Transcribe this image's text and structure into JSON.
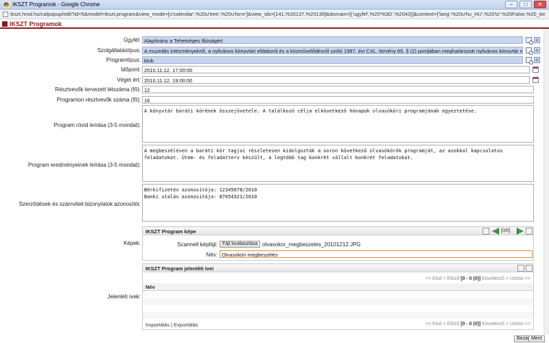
{
  "window": {
    "title": "IKSZT Programok - Google Chrome",
    "url": "ikszt.hrod.hu/calpopup/edit?id=5&model=ikszt.program&view_mode=[u'calendar',%20u'tree',%20u'form']&view_ids=[141,%20137,%20139]&domain=[('ugyfel',%20'%3D',%2043)]&context={'lang':%20u'hu_HU',%20'tz':%20False,%20_terp"
  },
  "app": {
    "title": "IKSZT Programok"
  },
  "form": {
    "ugyfel": {
      "label": "Ügyfél:",
      "value": "Alapítvány a Tehetséges Ifjúságért"
    },
    "szolgaltatas": {
      "label": "Szolgáltatástípus:",
      "value": "A muzeális intézményekről, a nyilvános könyvtári ellátásról és a közművelődésről szóló 1997. évi CXL. törvény 65. § (2) pontjában meghatározott nyilvános könyvtár működtetése vagy"
    },
    "programtipus": {
      "label": "Programtípus:",
      "value": "klub"
    },
    "idopont": {
      "label": "Időpont:",
      "value": "2010.11.12. 17:00:00"
    },
    "veget_ert": {
      "label": "Véget ért:",
      "value": "2010.11.12. 19:00:00"
    },
    "tervezett_letszam": {
      "label": "Résztvevők tervezett létszáma (fő):",
      "value": "12"
    },
    "resztvevok_szama": {
      "label": "Programon résztvevők száma (fő):",
      "value": "16"
    },
    "rovid_leiras": {
      "label": "Program rövid leírása (3-5 mondat):",
      "value": "A könyvtár baráti körének összejövetele. A találkozó célja elkövetkező hónapok olvasóköri programjának egyeztetése."
    },
    "eredmenyek": {
      "label": "Program eredményeinek leírása (3-5 mondat):",
      "value": "A megbeszélésen a baráti kör tagjai részletesen kidolgozták a soron következő olvasókörök programját, az azokkal kapcsolatos feladatokat. Ütem- és feladatterv készült, a legtöbb tag konkrét vállalt konkrét feladatokat."
    },
    "szerzodesek": {
      "label": "Szerződések és számviteli bizonylatok azonosítói:",
      "value": "Bérkifizetés azonosítója: 12345678/2010\nBanki utalás azonosítója: 87654321/2010"
    },
    "kepek_label": "Képek:",
    "jelenleti_label": "Jelenléti ívek:"
  },
  "kep_panel": {
    "title": "IKSZT Program képe",
    "counter": "[0/0]",
    "scan_label": "Scannelt képfájl:",
    "file_button": "Fájl kiválasztása",
    "file_name": "olvasokor_megbeszeles_20101212.JPG",
    "nev_label": "Név:",
    "nev_value": "Olvasóköri megbeszélés"
  },
  "jelenleti_panel": {
    "title": "IKSZT Program jelenléti ívei",
    "pager_first": "<< Első",
    "pager_prev": "< Előző",
    "pager_range": "[0 - 0 (0)]",
    "pager_next": "Következő >",
    "pager_last": "Utolsó >>",
    "column_nev": "Név",
    "import": "Importálás",
    "separator": "|",
    "export": "Exportálás"
  },
  "buttons": {
    "close": "Bezár",
    "save": "Ment"
  }
}
